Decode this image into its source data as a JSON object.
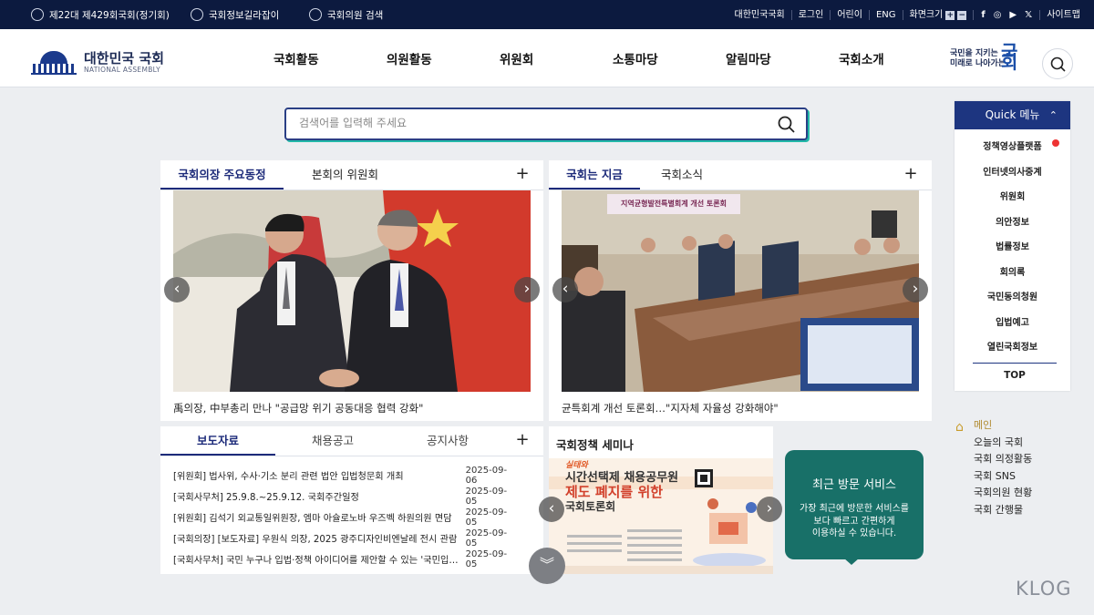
{
  "topbar": {
    "left": [
      "제22대 제429회국회(정기회)",
      "국회정보길라잡이",
      "국회의원 검색"
    ],
    "right": [
      "대한민국국회",
      "로그인",
      "어린이",
      "ENG"
    ],
    "zoom_label": "화면크기",
    "zoom_in": "+",
    "zoom_out": "−",
    "social": [
      "f",
      "◎",
      "▶",
      "𝕏"
    ],
    "sitemap": "사이트맵"
  },
  "logo": {
    "name": "대한민국 국회",
    "sub": "NATIONAL ASSEMBLY"
  },
  "gnb": [
    "국회활동",
    "의원활동",
    "위원회",
    "소통마당",
    "알림마당",
    "국회소개"
  ],
  "slogan": {
    "line1": "국민을 지키는",
    "line2": "미래로 나아가는",
    "big": "국회"
  },
  "search": {
    "placeholder": "검색어를 입력해 주세요"
  },
  "speaker": {
    "tabs": [
      "국회의장 주요동정",
      "본회의 위원회"
    ],
    "plus": "+",
    "caption": "禹의장, 中부총리 만나 \"공급망 위기 공동대응 협력 강화\"",
    "prev": "‹",
    "next": "›"
  },
  "now": {
    "tabs": [
      "국회는 지금",
      "국회소식"
    ],
    "plus": "+",
    "banner": "지역균형발전특별회계 개선 토론회",
    "caption": "균특회계 개선 토론회…\"지자체 자율성 강화해야\"",
    "prev": "‹",
    "next": "›"
  },
  "press": {
    "tabs": [
      "보도자료",
      "채용공고",
      "공지사항"
    ],
    "plus": "+",
    "items": [
      {
        "title": "[위원회] 법사위, 수사·기소 분리 관련 법안 입법청문회 개최",
        "date": "2025-09-06"
      },
      {
        "title": "[국회사무처] 25.9.8.~25.9.12. 국회주간일정",
        "date": "2025-09-05"
      },
      {
        "title": "[위원회] 김석기 외교통일위원장, 엠마 아슐로노바 우즈벡 하원의원 면담",
        "date": "2025-09-05"
      },
      {
        "title": "[국회의장] [보도자료] 우원식 의장, 2025 광주디자인비엔날레 전시 관람",
        "date": "2025-09-05"
      },
      {
        "title": "[국회사무처] 국민 누구나 입법·정책 아이디어를 제안할 수 있는 '국민입법제안' 플랫폼 운영",
        "date": "2025-09-05"
      }
    ]
  },
  "seminar": {
    "title": "국회정책 세미나",
    "tag": "실태와",
    "line1": "시간선택제 채용공무원",
    "line2": "제도 폐지를 위한",
    "line3": "국회토론회",
    "prev": "‹",
    "next": "›"
  },
  "scroll_down": "︾",
  "recent": {
    "title": "최근 방문 서비스",
    "desc": [
      "가장 최근에 방문한 서비스를",
      "보다 빠르고 간편하게",
      "이용하실 수 있습니다."
    ]
  },
  "quick": {
    "title": "Quick 메뉴",
    "items": [
      "정책영상플랫폼",
      "인터넷의사중계",
      "위원회",
      "의안정보",
      "법률정보",
      "회의록",
      "국민동의청원",
      "입법예고",
      "열린국회정보"
    ],
    "top": "TOP"
  },
  "sidelist": {
    "home": "메인",
    "items": [
      "오늘의 국회",
      "국회 의정활동",
      "국회 SNS",
      "국회의원 현황",
      "국회 간행물"
    ]
  },
  "watermark": "KLOG"
}
